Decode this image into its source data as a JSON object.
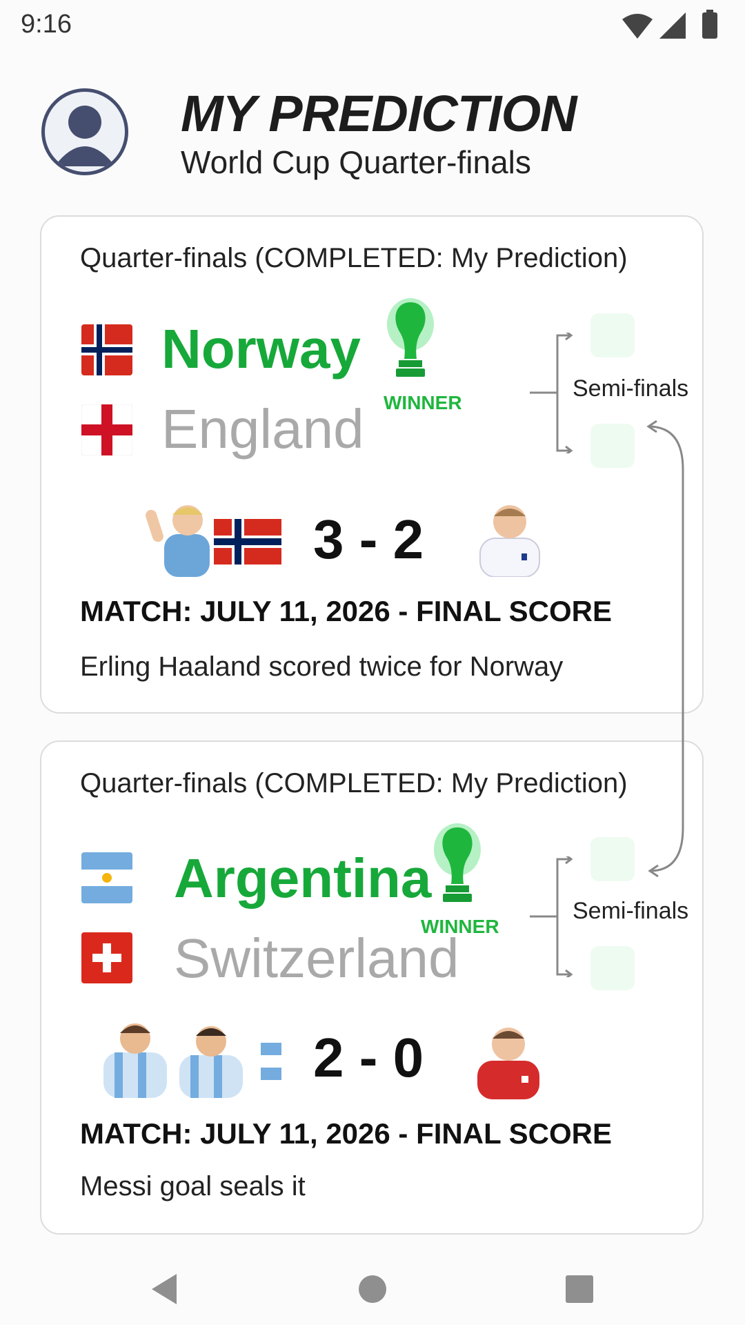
{
  "status_bar": {
    "time": "9:16",
    "icons": [
      "wifi-icon",
      "signal-icon",
      "battery-icon"
    ]
  },
  "header": {
    "title": "MY PREDICTION",
    "subtitle": "World Cup Quarter-finals",
    "avatar_icon": "user-avatar-icon"
  },
  "matches": [
    {
      "stage_label": "Quarter-finals (COMPLETED: My Prediction)",
      "winner": {
        "name": "Norway",
        "flag": "norway-flag"
      },
      "loser": {
        "name": "England",
        "flag": "england-flag"
      },
      "winner_badge": "WINNER",
      "next_round": "Semi-finals",
      "score": "3 - 2",
      "match_info": "MATCH: JULY 11, 2026 - FINAL SCORE",
      "note": "Erling Haaland scored twice for Norway"
    },
    {
      "stage_label": "Quarter-finals (COMPLETED: My Prediction)",
      "winner": {
        "name": "Argentina",
        "flag": "argentina-flag"
      },
      "loser": {
        "name": "Switzerland",
        "flag": "switzerland-flag"
      },
      "winner_badge": "WINNER",
      "next_round": "Semi-finals",
      "score": "2 - 0",
      "match_info": "MATCH: JULY 11, 2026 - FINAL SCORE",
      "note": "Messi goal seals it"
    }
  ],
  "colors": {
    "winner": "#17a83a",
    "loser": "#a9a9a9",
    "card_border": "#dcdcdc"
  },
  "nav_bar": {
    "icons": [
      "back-icon",
      "home-icon",
      "recents-icon"
    ]
  }
}
